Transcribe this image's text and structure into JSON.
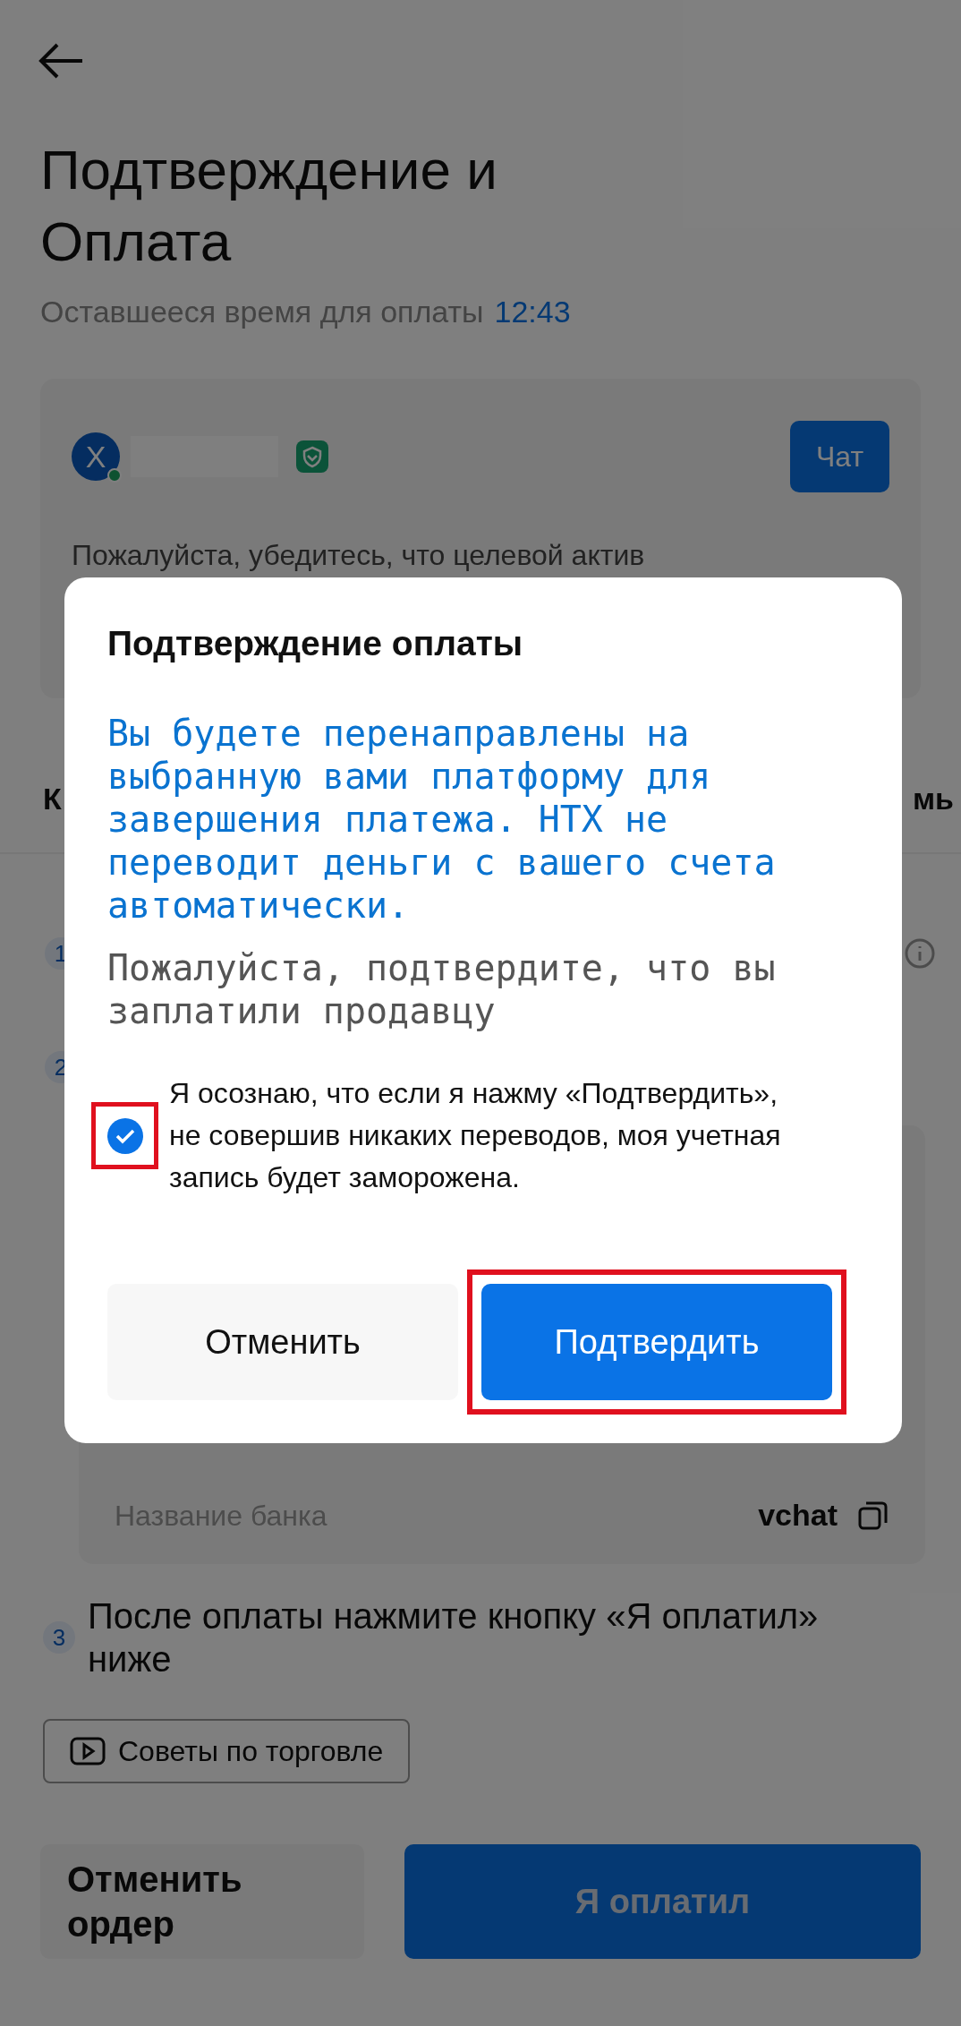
{
  "header": {
    "title": "Подтверждение и Оплата",
    "time_left_label": "Оставшееся время для оплаты",
    "timer": "12:43"
  },
  "seller_card": {
    "avatar_letter": "X",
    "online": true,
    "verified": true,
    "chat_button": "Чат",
    "notice": "Пожалуйста, убедитесь, что целевой актив"
  },
  "tabs": [
    {
      "label": "К"
    },
    {
      "label": "мь"
    }
  ],
  "steps": [
    {
      "number": "1",
      "info": true
    },
    {
      "number": "2"
    },
    {
      "number": "3",
      "text": "После оплаты нажмите кнопку «Я оплатил» ниже"
    }
  ],
  "payment_details": [
    {
      "label": "Название банка",
      "value": "vchat"
    }
  ],
  "tips_button": "Советы по торговле",
  "footer": {
    "cancel": "Отменить ордер",
    "paid": "Я оплатил"
  },
  "dialog": {
    "title": "Подтверждение оплаты",
    "notice": "Вы будете перенаправлены на выбранную вами платформу для завершения платежа. HTX не переводит деньги с вашего счета автоматически.",
    "prompt": "Пожалуйста, подтвердите, что вы заплатили продавцу",
    "acknowledgement": {
      "checked": true,
      "highlighted": true,
      "text": "Я осознаю, что если я нажму «Подтвердить», не совершив никаких переводов, моя учетная запись будет заморожена."
    },
    "buttons": [
      {
        "label": "Отменить",
        "kind": "secondary",
        "highlighted": false
      },
      {
        "label": "Подтвердить",
        "kind": "primary",
        "highlighted": true
      }
    ]
  }
}
